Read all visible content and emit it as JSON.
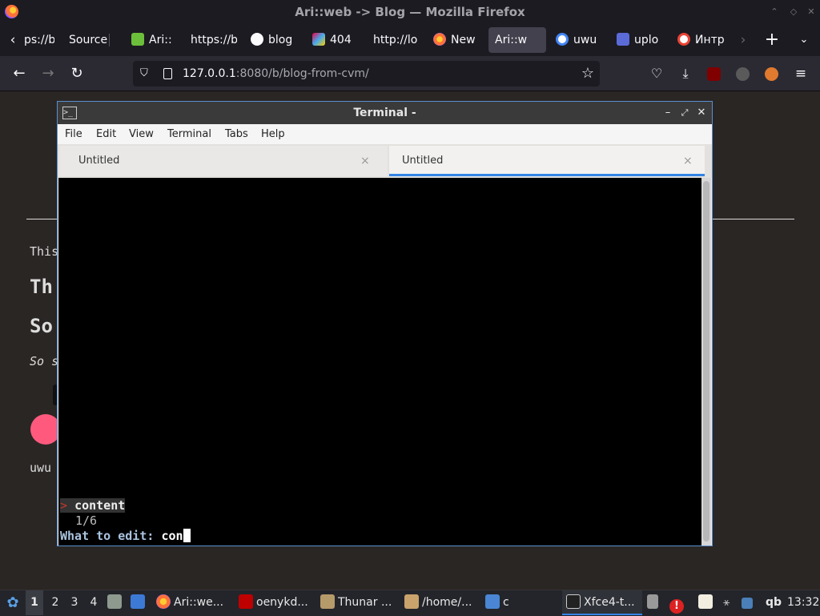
{
  "firefox": {
    "window_title": "Ari::web -> Blog — Mozilla Firefox",
    "tabs": [
      {
        "label": "ps://b",
        "icon": "none"
      },
      {
        "label": "Source",
        "icon": "none"
      },
      {
        "label": "Ari::",
        "icon": "leaf-icon"
      },
      {
        "label": "https://b",
        "icon": "none"
      },
      {
        "label": "blog",
        "icon": "github-icon"
      },
      {
        "label": "404",
        "icon": "sparkle-icon"
      },
      {
        "label": "http://lo",
        "icon": "none"
      },
      {
        "label": "New",
        "icon": "firefox-icon"
      },
      {
        "label": "Ari::w",
        "icon": "none",
        "active": true
      },
      {
        "label": "uwu",
        "icon": "google-icon"
      },
      {
        "label": "uplo",
        "icon": "upload-icon"
      },
      {
        "label": "Интр",
        "icon": "google-icon"
      }
    ],
    "url_host": "127.0.0.1",
    "url_path": ":8080/b/blog-from-cvm/"
  },
  "page": {
    "line1": "This",
    "heading1": "Th",
    "heading2": "So",
    "italic": "So s",
    "uwu": "uwu"
  },
  "terminal": {
    "title": "Terminal -",
    "menu": [
      "File",
      "Edit",
      "View",
      "Terminal",
      "Tabs",
      "Help"
    ],
    "tabs": [
      {
        "label": "Untitled",
        "active": false
      },
      {
        "label": "Untitled",
        "active": true
      }
    ],
    "close_glyph": "×",
    "prompt_marker": ">",
    "selected_item": "content",
    "counter": "1/6",
    "edit_prompt": "What to edit:",
    "edit_input": "con"
  },
  "taskbar": {
    "workspaces": [
      "1",
      "2",
      "3",
      "4"
    ],
    "apps": [
      {
        "label": "Ari::we...",
        "icon": "firefox-icon"
      },
      {
        "label": "oenykd...",
        "icon": "filezilla-icon"
      },
      {
        "label": "Thunar ...",
        "icon": "thunar-icon"
      },
      {
        "label": "/home/...",
        "icon": "archive-icon"
      },
      {
        "label": "c",
        "icon": "folder-icon"
      },
      {
        "label": "Xfce4-t...",
        "icon": "terminal-icon"
      }
    ],
    "tray_text": "qb",
    "clock": "13:32"
  },
  "colors": {
    "accent_blue": "#3584e4",
    "terminal_bg": "#000000",
    "prompt_red": "#c0392b",
    "pink_dot": "#ff5a7e"
  }
}
